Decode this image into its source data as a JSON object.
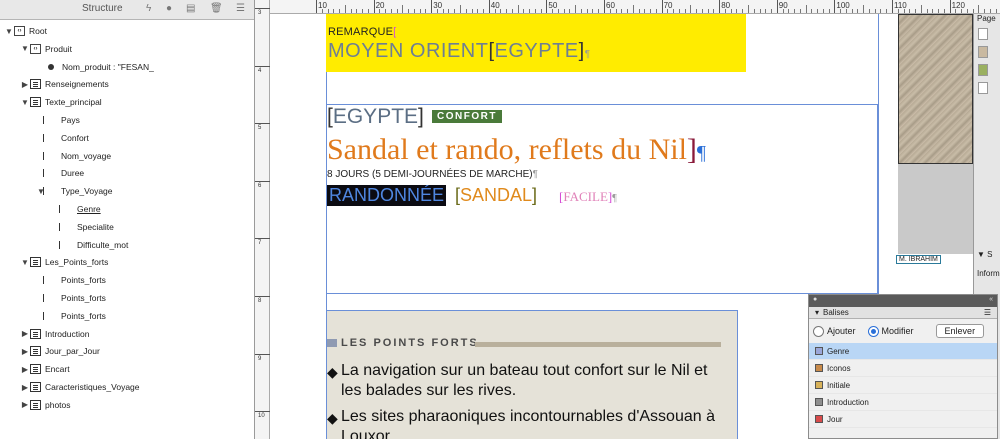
{
  "structure_panel": {
    "title": "Structure",
    "toolbar_icons": [
      "lightning-icon",
      "circle-icon",
      "tag-icon",
      "trash-icon",
      "panel-menu-icon"
    ],
    "tree": [
      {
        "label": "Root",
        "icon": "tag",
        "twisty": "▼"
      },
      {
        "label": "Produit",
        "icon": "tag",
        "twisty": "▼"
      },
      {
        "label": "Nom_produit : \"FESAN_",
        "icon": "dot",
        "twisty": ""
      },
      {
        "label": "Renseignements",
        "icon": "frame",
        "twisty": "▶"
      },
      {
        "label": "Texte_principal",
        "icon": "frame",
        "twisty": "▼"
      },
      {
        "label": "Pays",
        "icon": "story",
        "twisty": ""
      },
      {
        "label": "Confort",
        "icon": "story",
        "twisty": ""
      },
      {
        "label": "Nom_voyage",
        "icon": "story",
        "twisty": ""
      },
      {
        "label": "Duree",
        "icon": "story",
        "twisty": ""
      },
      {
        "label": "Type_Voyage",
        "icon": "story",
        "twisty": "▼"
      },
      {
        "label": "Genre",
        "icon": "story",
        "twisty": ""
      },
      {
        "label": "Specialite",
        "icon": "story",
        "twisty": ""
      },
      {
        "label": "Difficulte_mot",
        "icon": "story",
        "twisty": ""
      },
      {
        "label": "Les_Points_forts",
        "icon": "frame",
        "twisty": "▼"
      },
      {
        "label": "Points_forts",
        "icon": "story",
        "twisty": ""
      },
      {
        "label": "Points_forts",
        "icon": "story",
        "twisty": ""
      },
      {
        "label": "Points_forts",
        "icon": "story",
        "twisty": ""
      },
      {
        "label": "Introduction",
        "icon": "frame",
        "twisty": "▶"
      },
      {
        "label": "Jour_par_Jour",
        "icon": "frame",
        "twisty": "▶"
      },
      {
        "label": "Encart",
        "icon": "frame",
        "twisty": "▶"
      },
      {
        "label": "Caracteristiques_Voyage",
        "icon": "frame",
        "twisty": "▶"
      },
      {
        "label": "photos",
        "icon": "frame",
        "twisty": "▶"
      }
    ]
  },
  "ruler": {
    "h_labels": [
      "10",
      "20",
      "30",
      "40",
      "50",
      "60",
      "70",
      "80",
      "90",
      "100",
      "110",
      "120"
    ],
    "v_labels": [
      "3",
      "4",
      "5",
      "6",
      "7",
      "8",
      "9",
      "10"
    ]
  },
  "document": {
    "remarque": "REMARQUE",
    "destination": "MOYEN ORIENT",
    "destination_country": "EGYPTE",
    "pays": "EGYPTE",
    "confort": "CONFORT",
    "titre": "Sandal et rando, reflets du Nil",
    "duree": "8 JOURS (5 DEMI-JOURNÉES DE MARCHE)",
    "genre": "RANDONNÉE",
    "specialite": "SANDAL",
    "difficulte": "FACILE",
    "photo_caption": "M. IBRAHIM",
    "points_forts_title": "LES POINTS FORTS",
    "points_forts": [
      "La navigation sur un bateau tout confort sur le Nil et les balades sur les rives.",
      "Les sites pharaoniques incontournables d'Assouan à Louxor."
    ],
    "pilcrow": "¶",
    "bullet": "◆"
  },
  "right_panel": {
    "pages_label": "Page",
    "info_label": "Inform",
    "collapse_label": "▼ S"
  },
  "balises_panel": {
    "title": "Balises",
    "radio_add": "Ajouter",
    "radio_modify": "Modifier",
    "remove_button": "Enlever",
    "tags": [
      {
        "label": "Genre",
        "color": "#9aa6d8"
      },
      {
        "label": "Iconos",
        "color": "#c88a4a"
      },
      {
        "label": "Initiale",
        "color": "#d8b25a"
      },
      {
        "label": "Introduction",
        "color": "#8e8e8e"
      },
      {
        "label": "Jour",
        "color": "#d84a4a"
      }
    ]
  },
  "colors": {
    "yellow_frame": "#ffec00",
    "accent_orange": "#e07a1c",
    "confort_green": "#4a7a3a",
    "selection_blue": "#b9d6f5",
    "frame_edge": "#6a8fd8"
  }
}
